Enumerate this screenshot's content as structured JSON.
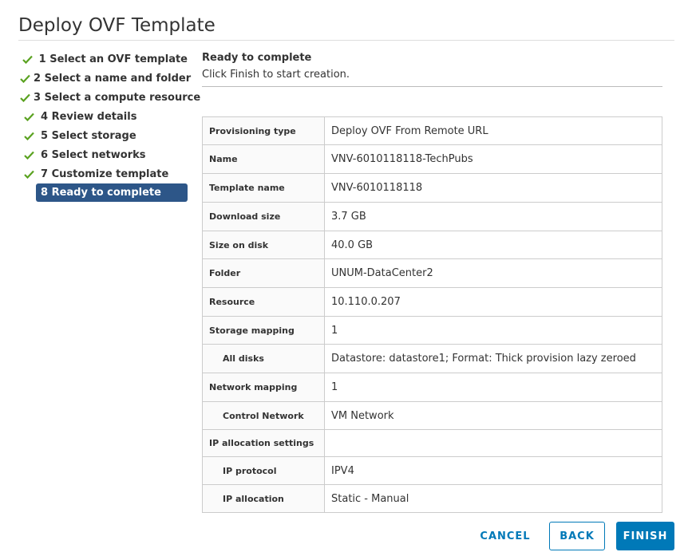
{
  "dialog": {
    "title": "Deploy OVF Template"
  },
  "steps": [
    {
      "label": "1 Select an OVF template",
      "done": true
    },
    {
      "label": "2 Select a name and folder",
      "done": true
    },
    {
      "label": "3 Select a compute resource",
      "done": true
    },
    {
      "label": "4 Review details",
      "done": true
    },
    {
      "label": "5 Select storage",
      "done": true
    },
    {
      "label": "6 Select networks",
      "done": true
    },
    {
      "label": "7 Customize template",
      "done": true
    },
    {
      "label": "8 Ready to complete",
      "active": true
    }
  ],
  "colors": {
    "check": "#5aa220",
    "active_step": "#2d5688",
    "primary": "#0079b8"
  },
  "icons": {
    "step_done": "checkmark-icon"
  },
  "content": {
    "heading": "Ready to complete",
    "subtext": "Click Finish to start creation."
  },
  "summary": {
    "rows": [
      {
        "key": "Provisioning type",
        "value": "Deploy OVF From Remote URL"
      },
      {
        "key": "Name",
        "value": "VNV-6010118118-TechPubs"
      },
      {
        "key": "Template name",
        "value": "VNV-6010118118"
      },
      {
        "key": "Download size",
        "value": "3.7 GB"
      },
      {
        "key": "Size on disk",
        "value": "40.0 GB"
      },
      {
        "key": "Folder",
        "value": "UNUM-DataCenter2"
      },
      {
        "key": "Resource",
        "value": "10.110.0.207"
      },
      {
        "key": "Storage mapping",
        "value": "1"
      },
      {
        "key": "All disks",
        "value": "Datastore: datastore1; Format: Thick provision lazy zeroed",
        "indent": true
      },
      {
        "key": "Network mapping",
        "value": "1"
      },
      {
        "key": "Control Network",
        "value": "VM Network",
        "indent": true
      },
      {
        "key": "IP allocation settings",
        "value": ""
      },
      {
        "key": "IP protocol",
        "value": "IPV4",
        "indent": true
      },
      {
        "key": "IP allocation",
        "value": "Static - Manual",
        "indent": true
      }
    ]
  },
  "footer": {
    "cancel_label": "CANCEL",
    "back_label": "BACK",
    "finish_label": "FINISH"
  }
}
